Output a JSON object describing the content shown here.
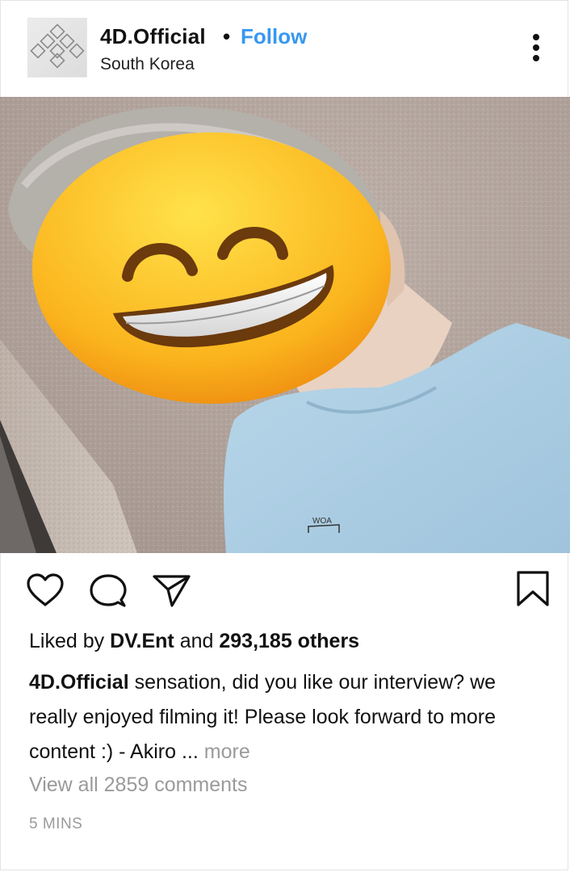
{
  "post": {
    "username": "4D.Official",
    "separator": "•",
    "follow_label": "Follow",
    "location": "South Korea",
    "shirt_logo_text": "WOA",
    "liked_by_prefix": "Liked by",
    "liked_by_user": "DV.Ent",
    "liked_by_and": "and",
    "liked_by_others": "293,185 others",
    "caption_user": "4D.Official",
    "caption_text": "sensation, did you like our interview? we really enjoyed filming it! Please look forward to more content :) - Akiro ...",
    "caption_more": "more",
    "view_comments": "View all 2859 comments",
    "timestamp": "5 MINS"
  },
  "icons": {
    "avatar": "diamond-logo-icon",
    "menu": "more-vertical-icon",
    "like": "heart-icon",
    "comment": "comment-bubble-icon",
    "share": "paper-plane-icon",
    "save": "bookmark-icon"
  },
  "colors": {
    "follow": "#3897f0",
    "secondary_text": "#9a9a9a"
  }
}
